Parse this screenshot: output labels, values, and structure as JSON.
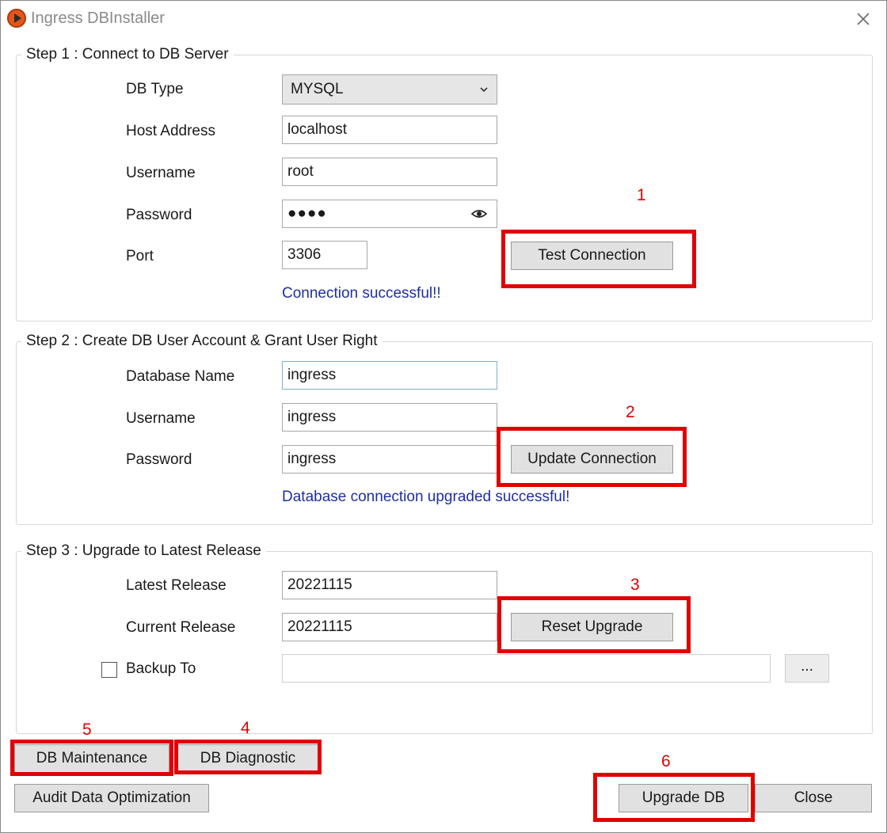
{
  "window": {
    "title": "Ingress DBInstaller"
  },
  "step1": {
    "legend": "Step 1 : Connect to DB Server",
    "db_type_label": "DB Type",
    "db_type_value": "MYSQL",
    "host_label": "Host Address",
    "host_value": "localhost",
    "username_label": "Username",
    "username_value": "root",
    "password_label": "Password",
    "password_value": "●●●●",
    "port_label": "Port",
    "port_value": "3306",
    "test_button": "Test Connection",
    "status": "Connection successful!!"
  },
  "step2": {
    "legend": "Step 2 : Create DB User Account & Grant User Right",
    "dbname_label": "Database Name",
    "dbname_value": "ingress",
    "username_label": "Username",
    "username_value": "ingress",
    "password_label": "Password",
    "password_value": "ingress",
    "update_button": "Update Connection",
    "status": "Database connection upgraded successful!"
  },
  "step3": {
    "legend": "Step 3 : Upgrade to Latest Release",
    "latest_label": "Latest Release",
    "latest_value": "20221115",
    "current_label": "Current Release",
    "current_value": "20221115",
    "reset_button": "Reset Upgrade",
    "backup_label": "Backup To",
    "backup_value": "",
    "browse_button": "..."
  },
  "buttons": {
    "maintenance": "DB Maintenance",
    "diagnostic": "DB Diagnostic",
    "audit": "Audit Data Optimization",
    "upgrade": "Upgrade DB",
    "close": "Close"
  },
  "annotations": [
    "1",
    "2",
    "3",
    "4",
    "5",
    "6"
  ],
  "colors": {
    "highlight": "#e00000",
    "status_text": "#1f2f9e",
    "app_icon": "#e2561d"
  },
  "icons": {
    "app": "play-logo-icon",
    "close": "close-icon",
    "dropdown": "chevron-down-icon",
    "reveal": "eye-icon"
  }
}
